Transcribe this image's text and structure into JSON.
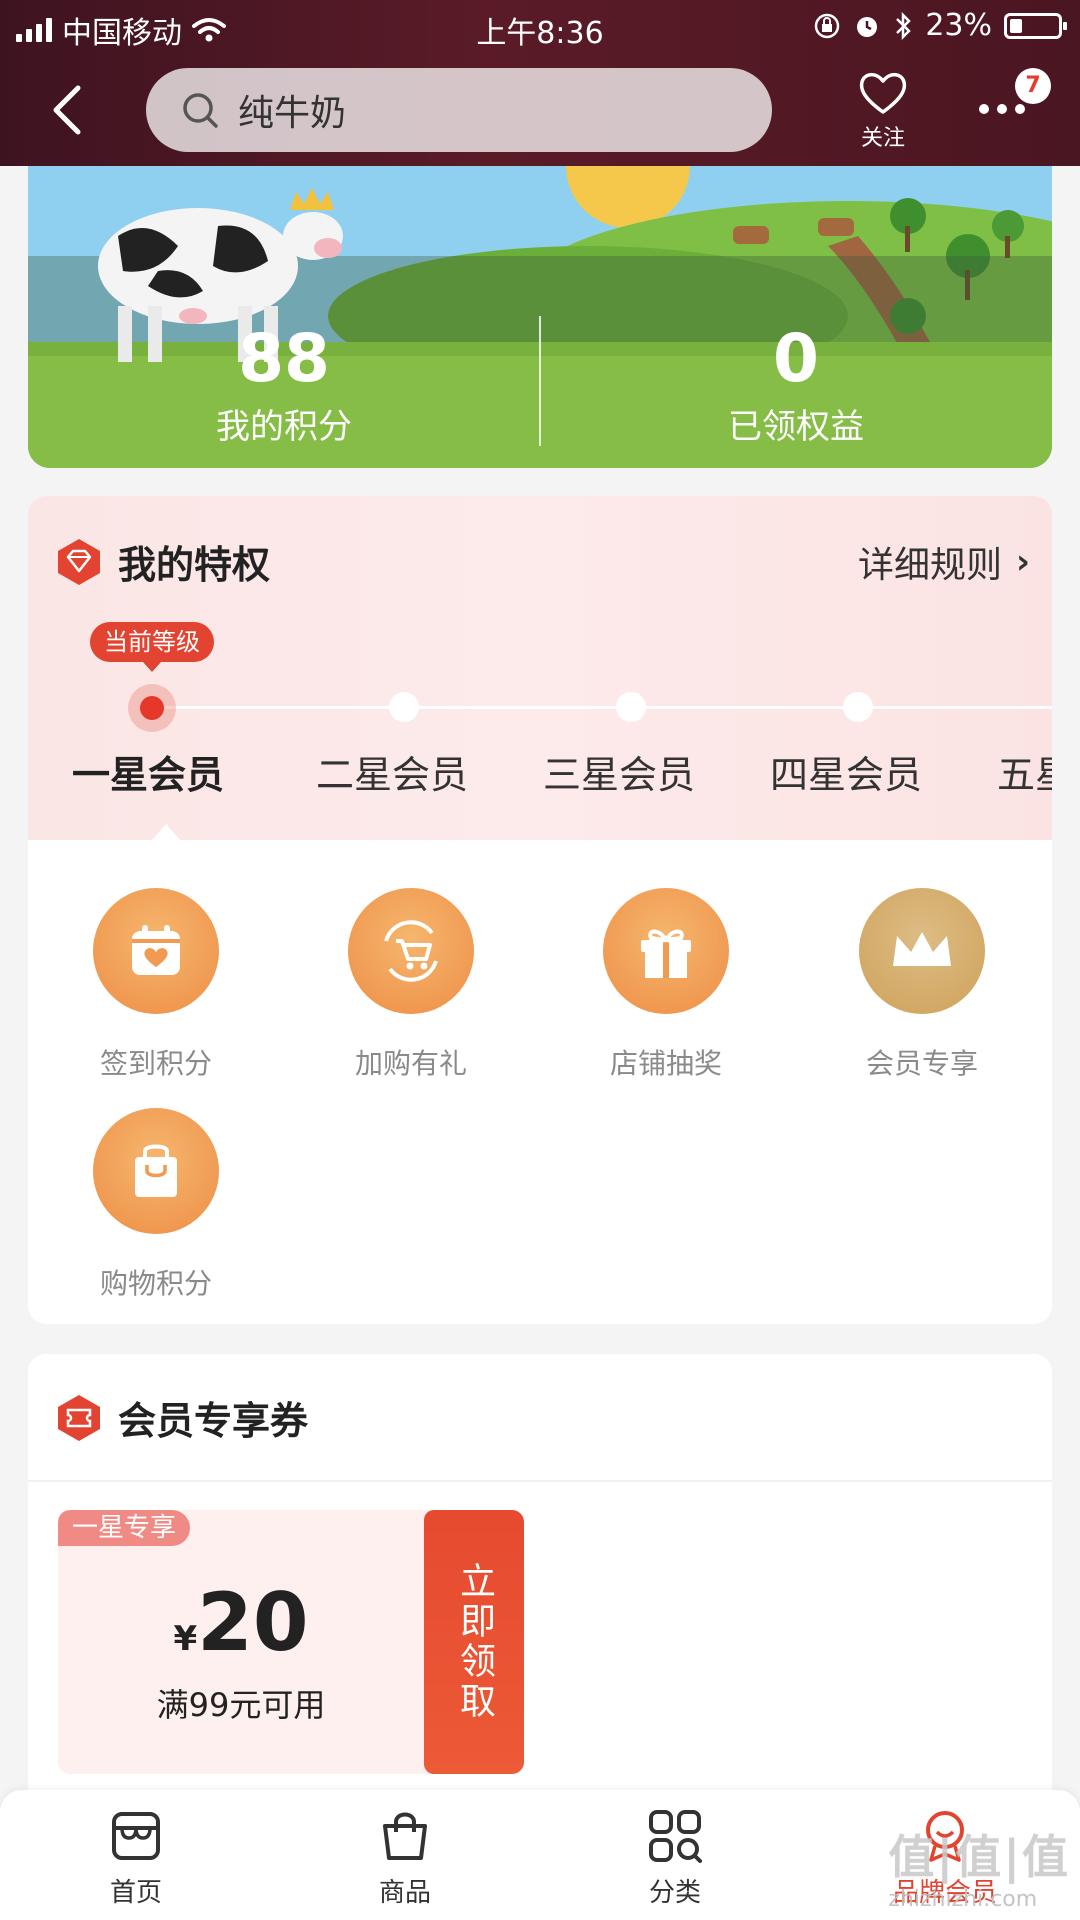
{
  "status_bar": {
    "carrier": "中国移动",
    "time": "上午8:36",
    "battery": "23%"
  },
  "header": {
    "search_text": "纯牛奶",
    "follow_label": "关注",
    "more_badge": "7"
  },
  "points": {
    "my_points_value": "88",
    "my_points_label": "我的积分",
    "benefits_value": "0",
    "benefits_label": "已领权益"
  },
  "privilege": {
    "title": "我的特权",
    "rules_label": "详细规则",
    "current_level_tag": "当前等级",
    "levels": [
      "一星会员",
      "二星会员",
      "三星会员",
      "四星会员",
      "五星"
    ],
    "perks": [
      {
        "label": "签到积分",
        "icon": "calendar-heart-icon"
      },
      {
        "label": "加购有礼",
        "icon": "cart-refresh-icon"
      },
      {
        "label": "店铺抽奖",
        "icon": "gift-icon"
      },
      {
        "label": "会员专享",
        "icon": "crown-icon"
      },
      {
        "label": "购物积分",
        "icon": "shopping-bag-icon"
      }
    ]
  },
  "coupons": {
    "title": "会员专享券",
    "items": [
      {
        "tag": "一星专享",
        "currency": "¥",
        "amount": "20",
        "condition": "满99元可用",
        "claim_label": "立即领取"
      }
    ]
  },
  "bottom_nav": {
    "items": [
      {
        "label": "首页",
        "icon": "shop-icon"
      },
      {
        "label": "商品",
        "icon": "bag-icon"
      },
      {
        "label": "分类",
        "icon": "grid-icon"
      },
      {
        "label": "品牌会员",
        "icon": "member-icon"
      }
    ],
    "active_color": "#e34432"
  },
  "watermark": {
    "brand": "值|值|值",
    "url": "zhizhizhi.com"
  },
  "colors": {
    "accent": "#e34432",
    "header_bg": "#4a1621",
    "perk_orange": "#f09a52",
    "perk_gold": "#d2a864"
  }
}
